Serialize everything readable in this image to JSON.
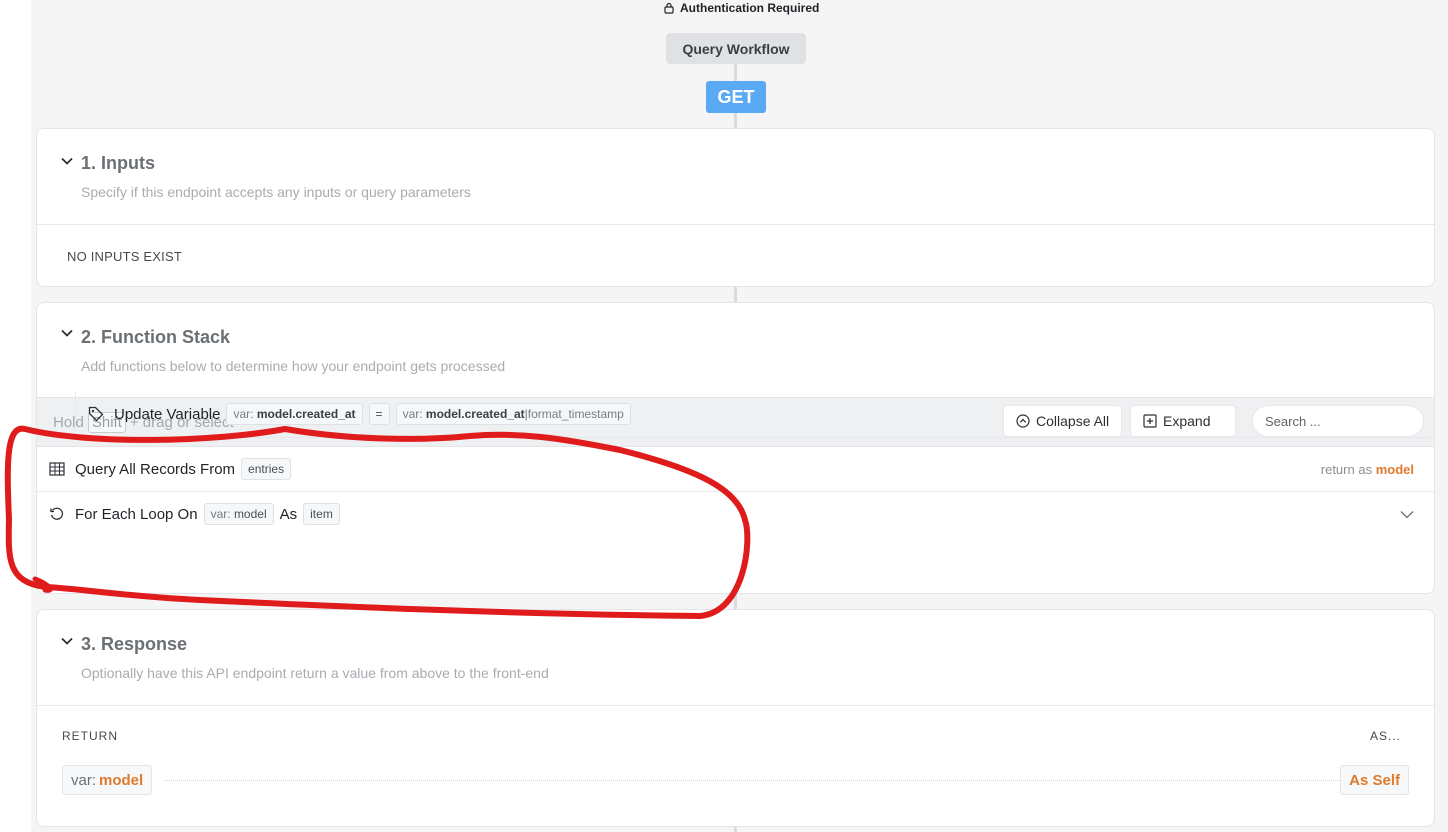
{
  "header": {
    "auth_label": "Authentication Required",
    "workflow_label": "Query Workflow",
    "method": "GET"
  },
  "inputs": {
    "title": "1. Inputs",
    "subtitle": "Specify if this endpoint accepts any inputs or query parameters",
    "empty_text": "NO INPUTS EXIST"
  },
  "function_stack": {
    "title": "2. Function Stack",
    "subtitle": "Add functions below to determine how your endpoint gets processed",
    "hint_prefix": "Hold",
    "hint_key": "Shift",
    "hint_suffix": "+ drag or select",
    "collapse_all_label": "Collapse All",
    "expand_label": "Expand",
    "search_placeholder": "Search ...",
    "items": [
      {
        "label": "Query All Records From",
        "table": "entries",
        "return_prefix": "return as",
        "return_var": "model",
        "icon": "table-icon"
      },
      {
        "label": "For Each Loop On",
        "var_prefix": "var:",
        "var_name": "model",
        "as_label": "As",
        "item_name": "item",
        "icon": "loop-icon"
      },
      {
        "label": "Update Variable",
        "target_prefix": "var:",
        "target_name": "model.created_at",
        "operator": "=",
        "value_prefix": "var:",
        "value_name": "model.created_at",
        "value_filter": "|format_timestamp",
        "icon": "tag-icon"
      }
    ]
  },
  "response": {
    "title": "3. Response",
    "subtitle": "Optionally have this API endpoint return a value from above to the front-end",
    "return_label": "RETURN",
    "as_label": "AS...",
    "return_var_prefix": "var:",
    "return_var_name": "model",
    "as_value": "As Self"
  },
  "colors": {
    "accent_orange": "#e07a2c",
    "method_blue": "#5aa9f5",
    "annotation_red": "#e01b1b"
  }
}
